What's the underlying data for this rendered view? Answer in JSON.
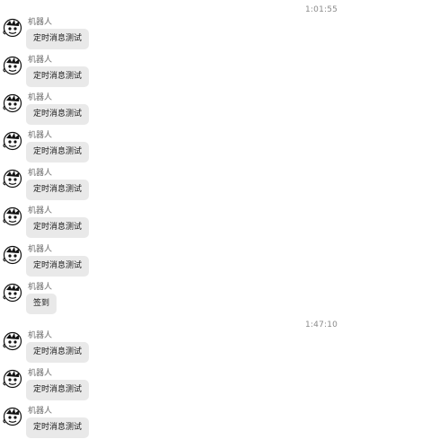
{
  "timestamps": [
    "1:01:55",
    "1:47:10"
  ],
  "messages": [
    {
      "sender": "机器人",
      "text": "定时消息测试"
    },
    {
      "sender": "机器人",
      "text": "定时消息测试"
    },
    {
      "sender": "机器人",
      "text": "定时消息测试"
    },
    {
      "sender": "机器人",
      "text": "定时消息测试"
    },
    {
      "sender": "机器人",
      "text": "定时消息测试"
    },
    {
      "sender": "机器人",
      "text": "定时消息测试"
    },
    {
      "sender": "机器人",
      "text": "定时消息测试"
    },
    {
      "sender": "机器人",
      "text": "签到"
    },
    {
      "sender": "机器人",
      "text": "定时消息测试"
    },
    {
      "sender": "机器人",
      "text": "定时消息测试"
    },
    {
      "sender": "机器人",
      "text": "定时消息测试"
    }
  ],
  "avatar_icon": "robot-comic-avatar-icon"
}
